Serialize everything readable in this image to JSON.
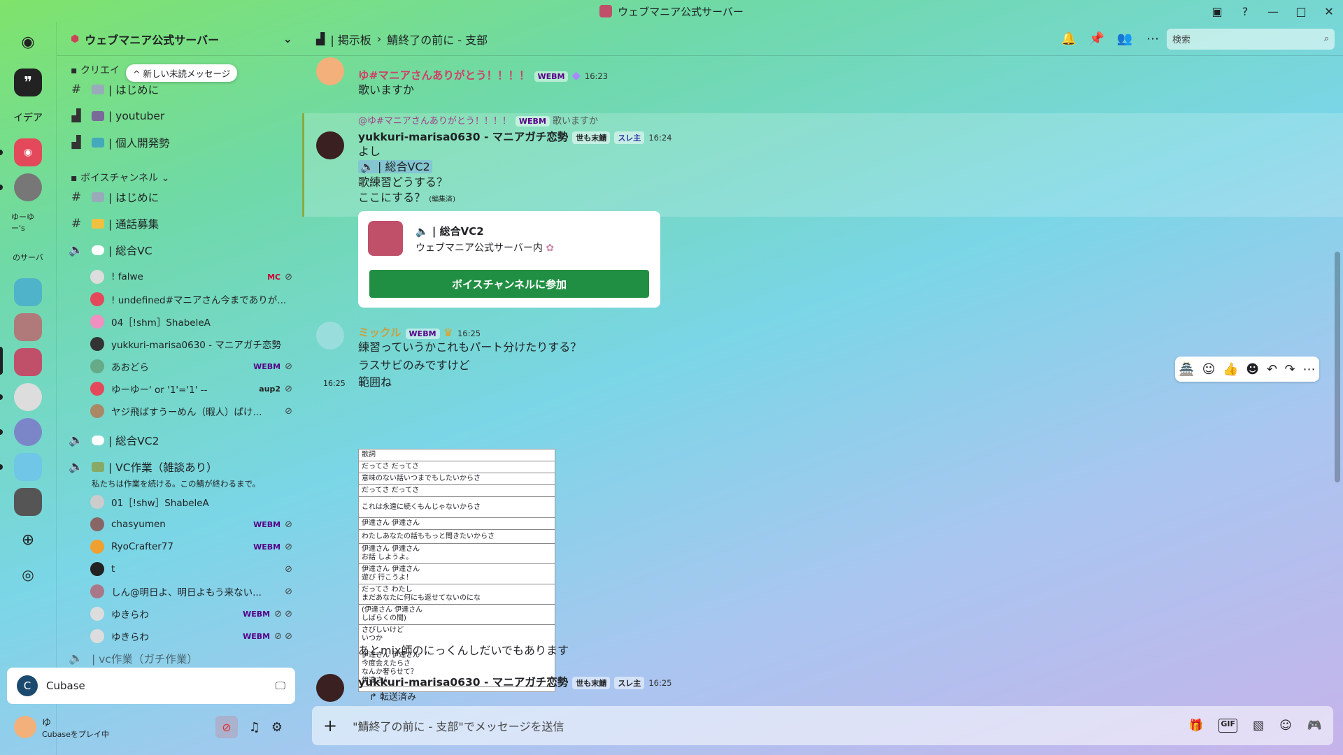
{
  "window": {
    "title": "ウェブマニア公式サーバー"
  },
  "guilds": {
    "labels": [
      "イデア",
      "ゆーゆー's",
      "のサーバ"
    ]
  },
  "server": {
    "name": "ウェブマニア公式サーバー",
    "toast": "^ 新しい未読メッセージ"
  },
  "channels": {
    "cat1": "クリエイ",
    "text": [
      {
        "label": "| はじめに"
      },
      {
        "label": "| youtuber"
      },
      {
        "label": "| 個人開発勢"
      }
    ],
    "voice_cat": "ボイスチャンネル",
    "voice_text": [
      {
        "label": "| はじめに"
      },
      {
        "label": "| 通話募集"
      }
    ],
    "vc1": "| 総合VC",
    "vc1_members": [
      {
        "name": "! falwe",
        "tag": "MC"
      },
      {
        "name": "! undefined#マニアさん今までありが...",
        "tag": ""
      },
      {
        "name": "04［!shm］ShabeleA",
        "tag": ""
      },
      {
        "name": "yukkuri-marisa0630 - マニアガチ恋勢",
        "tag": ""
      },
      {
        "name": "あおどら",
        "tag": "WEBM"
      },
      {
        "name": "ゆーゆー' or '1'='1' --",
        "tag": "aup2"
      },
      {
        "name": "ヤジ飛ばすうーめん（暇人）ぱけ...",
        "tag": ""
      }
    ],
    "vc2": "| 総合VC2",
    "vc3": "| VC作業（雑談あり）",
    "vc3_status": "私たちは作業を続ける。この鯖が終わるまで。",
    "vc3_members": [
      {
        "name": "01［!shw］ShabeleA",
        "tag": ""
      },
      {
        "name": "chasyumen",
        "tag": "WEBM"
      },
      {
        "name": "RyoCrafter77",
        "tag": "WEBM"
      },
      {
        "name": "t",
        "tag": ""
      },
      {
        "name": "しん@明日よ、明日よもう来ない...",
        "tag": ""
      },
      {
        "name": "ゆきらわ",
        "tag": "WEBM"
      },
      {
        "name": "ゆきらわ",
        "tag": "WEBM"
      }
    ],
    "more": "| vc作業（ガチ作業）"
  },
  "activity": {
    "app": "Cubase"
  },
  "user": {
    "name": "ゆ",
    "status": "Cubaseをプレイ中"
  },
  "header": {
    "forum": "| 掲示板",
    "sep": "›",
    "thread": "鯖終了の前に - 支部",
    "search_placeholder": "検索"
  },
  "messages": {
    "m1": {
      "author": "ゆ#マニアさんありがとう！！！！",
      "badge": "WEBM",
      "time": "16:23",
      "text": "歌いますか"
    },
    "reply": {
      "author": "@ゆ#マニアさんありがとう！！！！",
      "badge": "WEBM",
      "text": "歌いますか"
    },
    "m2": {
      "author": "yukkuri-marisa0630 - マニアガチ恋勢",
      "badge": "世も末鯖",
      "role": "スレ主",
      "time": "16:24",
      "lines": [
        "よし",
        "| 総合VC2",
        "歌練習どうする？",
        "ここにする？"
      ],
      "edited": "(編集済)"
    },
    "embed": {
      "title": "| 総合VC2",
      "sub": "ウェブマニア公式サーバー内",
      "button": "ボイスチャンネルに参加"
    },
    "m3": {
      "author": "ミックル",
      "badge": "WEBM",
      "time": "16:25",
      "lines": [
        "練習っていうかこれもパート分けたりする？",
        "ラスサビのみですけど"
      ]
    },
    "m4": {
      "time": "16:25",
      "text": "範囲ね"
    },
    "lyrics": [
      "歌詞",
      "だってさ だってさ",
      "意味のない話いつまでもしたいからさ",
      "だってさ だってさ",
      "これは永遠に続くもんじゃないからさ",
      "伊達さん 伊達さん",
      "わたしあなたの話ももっと聞きたいからさ",
      "伊達さん 伊達さん\nお話 しようよ。",
      "伊達さん 伊達さん\n遊び 行こうよ！",
      "だってさ わたし\nまだあなたに何にも返せてないのにな",
      "(伊達さん 伊達さん\nしばらくの間)",
      "さびしいけど\nいつか\n\n伊達さん 伊達さん\n今度会えたらさ\nなんか奢らせて？\n伊達さん"
    ],
    "m5": {
      "text": "あとmix師のにっくんしだいでもあります"
    },
    "m6": {
      "author": "yukkuri-marisa0630 - マニアガチ恋勢",
      "badge": "世も末鯖",
      "role": "スレ主",
      "time": "16:25",
      "forward": "転送済み"
    }
  },
  "composer": {
    "placeholder": "\"鯖終了の前に - 支部\"でメッセージを送信"
  }
}
